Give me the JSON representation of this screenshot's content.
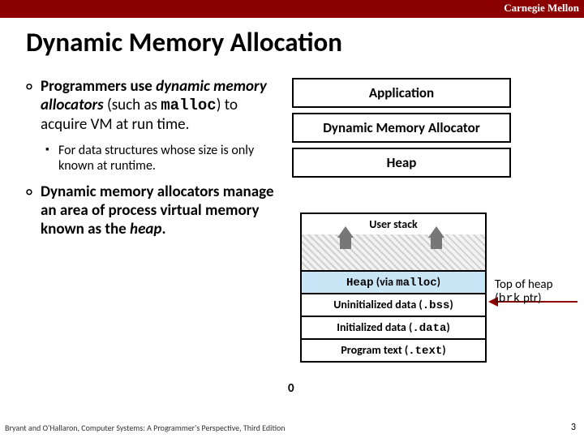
{
  "header": {
    "org": "Carnegie Mellon"
  },
  "title": "Dynamic Memory Allocation",
  "bullets": {
    "b1_pre": "Programmers use ",
    "b1_em": "dynamic memory allocators",
    "b1_mid": " (such as ",
    "b1_code": "malloc",
    "b1_post": ") to acquire VM at run time.",
    "b1a": "For data structures whose size is only known at runtime.",
    "b2_pre": "Dynamic memory allocators manage an area of process virtual memory known as the ",
    "b2_em": "heap",
    "b2_post": "."
  },
  "topboxes": {
    "app": "Application",
    "dma": "Dynamic Memory Allocator",
    "heap": "Heap"
  },
  "mem": {
    "stack": "User stack",
    "heap_pre": "Heap",
    "heap_mid": " (via ",
    "heap_code": "malloc",
    "heap_post": ")",
    "bss_pre": "Uninitialized data (",
    "bss_code": ".bss",
    "bss_post": ")",
    "data_pre": "Initialized data (",
    "data_code": ".data",
    "data_post": ")",
    "text_pre": "Program text (",
    "text_code": ".text",
    "text_post": ")",
    "zero": "0"
  },
  "brk": {
    "line1": "Top of heap",
    "line2_pre": "(",
    "line2_code": "brk",
    "line2_post": " ptr)"
  },
  "footer": "Bryant and O'Hallaron, Computer Systems: A Programmer's Perspective, Third Edition",
  "page": "3"
}
